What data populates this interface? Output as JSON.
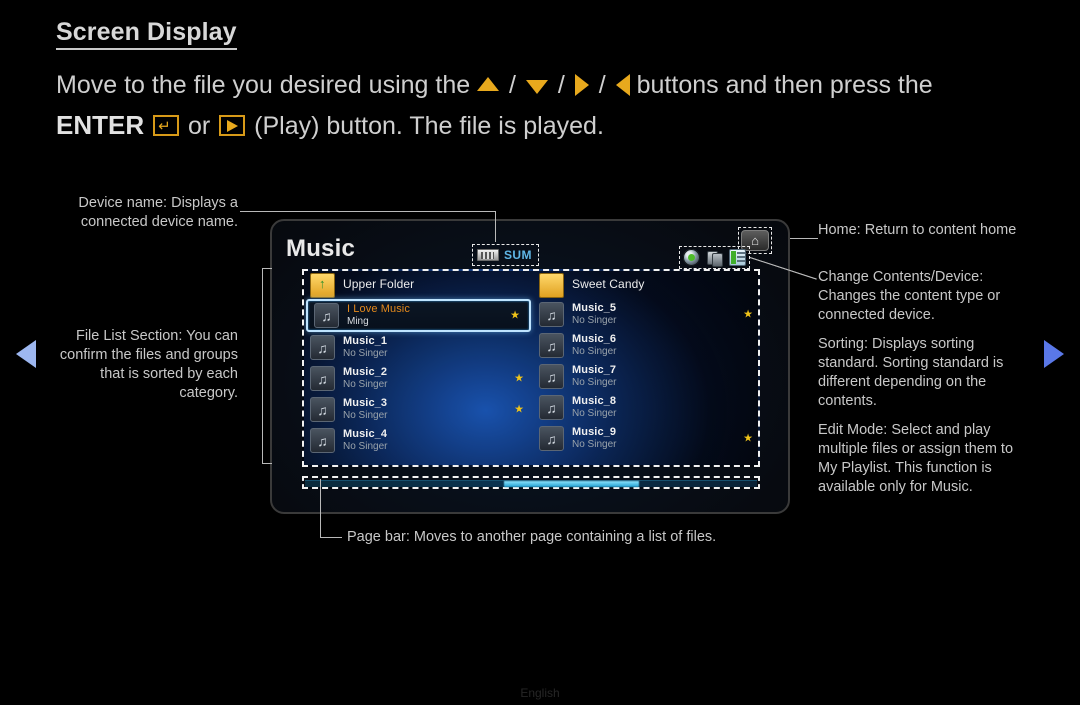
{
  "page": {
    "title": "Screen Display",
    "footer_language": "English"
  },
  "instructions": {
    "line1_a": "Move to the file you desired using the",
    "line1_b": "buttons and then press the",
    "line2_enter": "ENTER",
    "line2_or": "or",
    "line2_rest": "(Play) button. The file is played.",
    "arrow_up": "up-arrow",
    "arrow_down": "down-arrow",
    "arrow_right": "right-arrow",
    "arrow_left": "left-arrow",
    "separator": "/",
    "enter_glyph": "↵",
    "accent_color": "#e8a91d"
  },
  "nav": {
    "prev_label": "previous-page-arrow",
    "next_label": "next-page-arrow",
    "prev_color": "#9db7f0",
    "next_color": "#5a78e8"
  },
  "tv_screen": {
    "title": "Music",
    "device_badge": {
      "label": "SUM",
      "icon": "usb-device-icon",
      "label_color": "#5fb6e6"
    },
    "home_button": {
      "label": "home-icon",
      "glyph": "⌂"
    },
    "tool_icons": [
      {
        "name": "change-contents-device-icon"
      },
      {
        "name": "sorting-icon"
      },
      {
        "name": "edit-mode-icon"
      }
    ],
    "file_list": {
      "left_column": [
        {
          "type": "folder",
          "title": "Upper Folder",
          "subtitle": "",
          "starred": false,
          "selected": false,
          "icon": "folder-up-icon"
        },
        {
          "type": "music",
          "title": "I Love Music",
          "subtitle": "Ming",
          "starred": true,
          "selected": true,
          "icon": "music-note-icon"
        },
        {
          "type": "music",
          "title": "Music_1",
          "subtitle": "No Singer",
          "starred": false,
          "selected": false,
          "icon": "music-note-icon"
        },
        {
          "type": "music",
          "title": "Music_2",
          "subtitle": "No Singer",
          "starred": true,
          "selected": false,
          "icon": "music-note-icon"
        },
        {
          "type": "music",
          "title": "Music_3",
          "subtitle": "No Singer",
          "starred": true,
          "selected": false,
          "icon": "music-note-icon"
        },
        {
          "type": "music",
          "title": "Music_4",
          "subtitle": "No Singer",
          "starred": false,
          "selected": false,
          "icon": "music-note-icon"
        }
      ],
      "right_column": [
        {
          "type": "folder",
          "title": "Sweet Candy",
          "subtitle": "",
          "starred": false,
          "selected": false,
          "icon": "folder-icon"
        },
        {
          "type": "music",
          "title": "Music_5",
          "subtitle": "No Singer",
          "starred": true,
          "selected": false,
          "icon": "music-note-icon"
        },
        {
          "type": "music",
          "title": "Music_6",
          "subtitle": "No Singer",
          "starred": false,
          "selected": false,
          "icon": "music-note-icon"
        },
        {
          "type": "music",
          "title": "Music_7",
          "subtitle": "No Singer",
          "starred": false,
          "selected": false,
          "icon": "music-note-icon"
        },
        {
          "type": "music",
          "title": "Music_8",
          "subtitle": "No Singer",
          "starred": false,
          "selected": false,
          "icon": "music-note-icon"
        },
        {
          "type": "music",
          "title": "Music_9",
          "subtitle": "No Singer",
          "starred": true,
          "selected": false,
          "icon": "music-note-icon"
        }
      ],
      "star_color": "#f0c419",
      "selected_title_color": "#e4891c"
    },
    "page_bar": {
      "name": "page-bar",
      "thumb_position_percent": 44,
      "thumb_width_percent": 30
    }
  },
  "callouts": {
    "device_name": "Device name: Displays a connected device name.",
    "file_list_section": "File List Section: You can confirm the files and groups that is sorted by each category.",
    "page_bar": "Page bar: Moves to another page containing a list of files.",
    "home": "Home: Return to content home",
    "change_contents": "Change Contents/Device: Changes the content type or connected device.",
    "sorting": "Sorting: Displays sorting standard. Sorting standard is different depending on the contents.",
    "edit_mode": "Edit Mode: Select and play multiple files or assign them to My Playlist. This function is available only for Music."
  }
}
